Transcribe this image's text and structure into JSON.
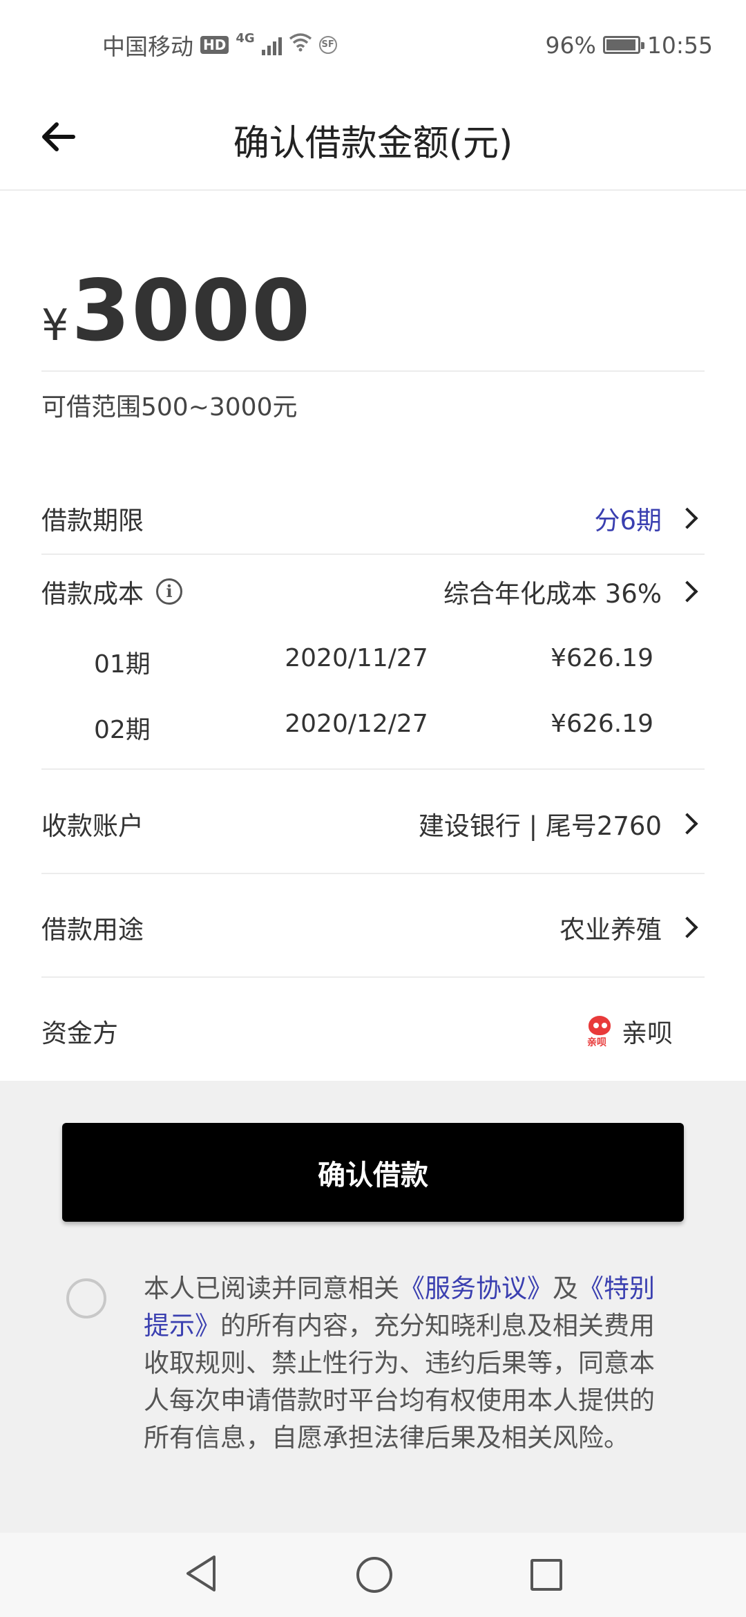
{
  "status_bar": {
    "carrier": "中国移动",
    "hd": "HD",
    "network": "4G",
    "sf": "SF",
    "battery_percent": "96%",
    "battery_level": 0.96,
    "time": "10:55"
  },
  "header": {
    "title": "确认借款金额(元)"
  },
  "amount": {
    "currency": "¥",
    "value": "3000",
    "range_text": "可借范围500~3000元"
  },
  "loan_term": {
    "label": "借款期限",
    "value": "分6期"
  },
  "loan_cost": {
    "label": "借款成本",
    "value": "综合年化成本 36%"
  },
  "installments": [
    {
      "period": "01期",
      "date": "2020/11/27",
      "amount": "¥626.19"
    },
    {
      "period": "02期",
      "date": "2020/12/27",
      "amount": "¥626.19"
    }
  ],
  "account": {
    "label": "收款账户",
    "value": "建设银行 | 尾号2760"
  },
  "purpose": {
    "label": "借款用途",
    "value": "农业养殖"
  },
  "funder": {
    "label": "资金方",
    "logo_text": "亲呗",
    "value": "亲呗"
  },
  "confirm_button": "确认借款",
  "agreement": {
    "prefix": "本人已阅读并同意相关",
    "link1": "《服务协议》",
    "middle": "及",
    "link2": "《特别提示》",
    "suffix": "的所有内容，充分知晓利息及相关费用收取规则、禁止性行为、违约后果等，同意本人每次申请借款时平台均有权使用本人提供的所有信息，自愿承担法律后果及相关风险。"
  },
  "colors": {
    "accent_blue": "#3a3fb0",
    "button_bg": "#000000",
    "footer_bg": "#f0f0f0"
  }
}
